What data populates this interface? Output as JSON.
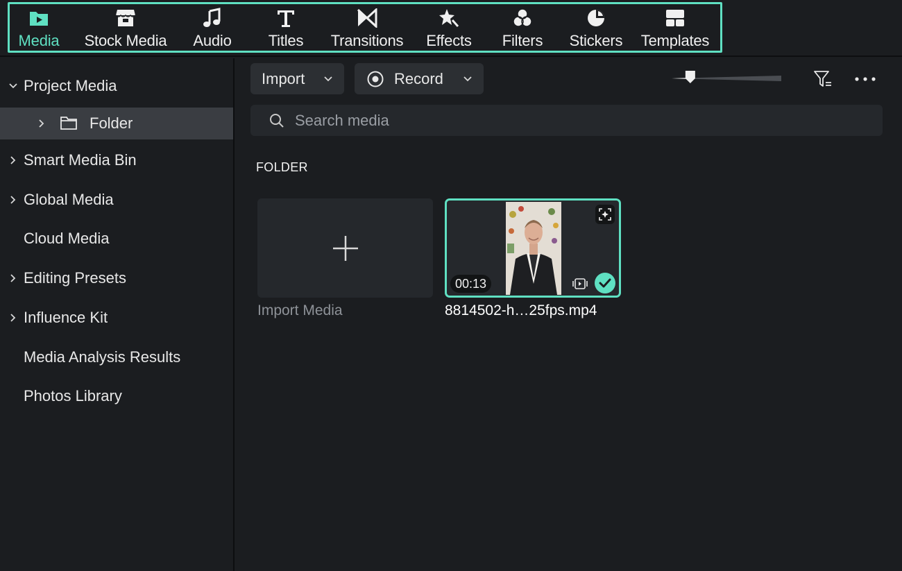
{
  "tabs": [
    {
      "label": "Media",
      "icon": "media-folder-icon",
      "active": true
    },
    {
      "label": "Stock Media",
      "icon": "store-icon",
      "active": false
    },
    {
      "label": "Audio",
      "icon": "music-note-icon",
      "active": false
    },
    {
      "label": "Titles",
      "icon": "text-t-icon",
      "active": false
    },
    {
      "label": "Transitions",
      "icon": "transition-bowtie-icon",
      "active": false
    },
    {
      "label": "Effects",
      "icon": "star-effects-icon",
      "active": false
    },
    {
      "label": "Filters",
      "icon": "overlap-circles-icon",
      "active": false
    },
    {
      "label": "Stickers",
      "icon": "pie-sticker-icon",
      "active": false
    },
    {
      "label": "Templates",
      "icon": "layout-template-icon",
      "active": false
    }
  ],
  "sidebar": {
    "items": [
      {
        "label": "Project Media",
        "chevron": "down"
      },
      {
        "label": "Folder",
        "chevron": "right",
        "selected": true
      },
      {
        "label": "Smart Media Bin",
        "chevron": "right"
      },
      {
        "label": "Global Media",
        "chevron": "right"
      },
      {
        "label": "Cloud Media",
        "chevron": "none"
      },
      {
        "label": "Editing Presets",
        "chevron": "right"
      },
      {
        "label": "Influence Kit",
        "chevron": "right"
      },
      {
        "label": "Media Analysis Results",
        "chevron": "none"
      },
      {
        "label": "Photos Library",
        "chevron": "none"
      }
    ]
  },
  "toolbar": {
    "import_label": "Import",
    "record_label": "Record",
    "zoom_level": 0.17
  },
  "search": {
    "placeholder": "Search media"
  },
  "section": {
    "title": "FOLDER"
  },
  "import_card": {
    "caption": "Import Media"
  },
  "clip": {
    "duration": "00:13",
    "filename": "8814502-h…25fps.mp4",
    "selected": true
  },
  "colors": {
    "accent": "#5fe0c2",
    "background": "#1b1d20",
    "panel": "#25282c",
    "button": "#2c2f33",
    "selected_row": "#3a3d42"
  }
}
